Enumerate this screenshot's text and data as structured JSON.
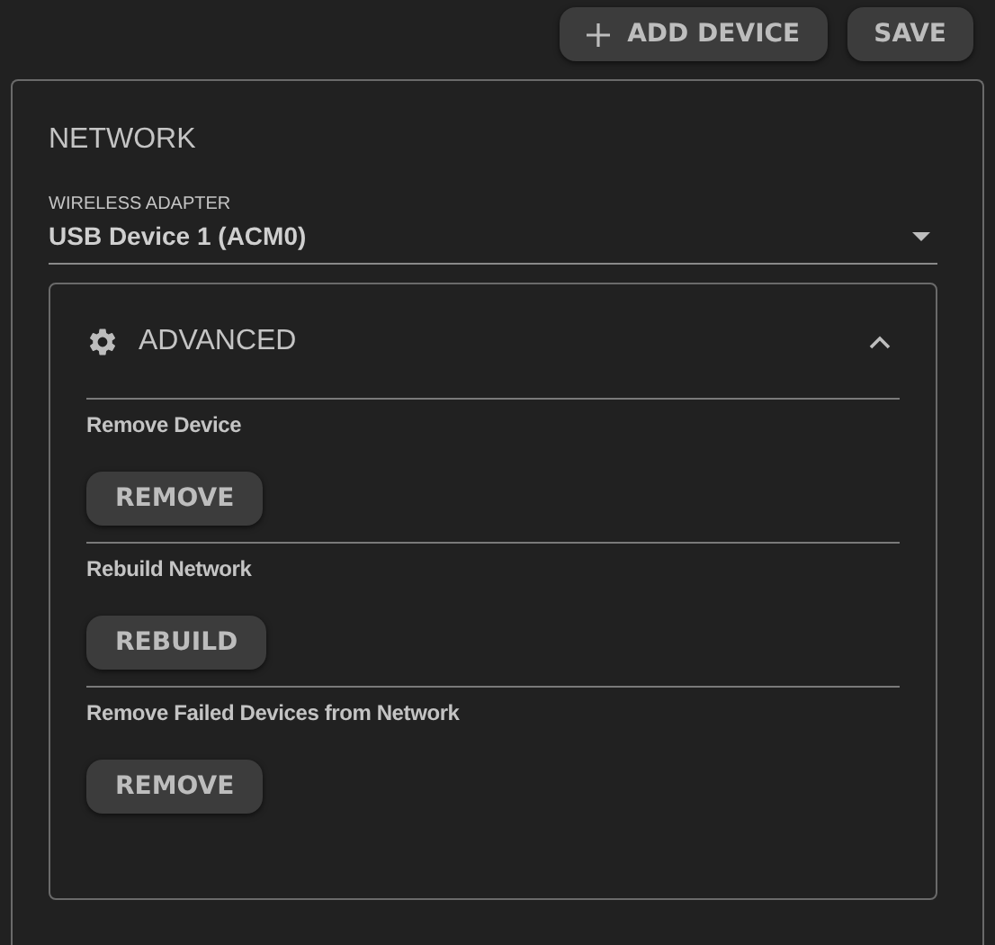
{
  "toolbar": [
    {
      "label": "ADD DEVICE",
      "kind": "add"
    },
    {
      "label": "SAVE",
      "kind": "plain"
    }
  ],
  "network": {
    "title": "NETWORK",
    "adapter": {
      "label": "WIRELESS ADAPTER",
      "value": "USB Device 1 (ACM0)"
    },
    "advanced": {
      "title": "ADVANCED",
      "expanded": true,
      "sections": [
        {
          "label": "Remove Device",
          "button": "REMOVE"
        },
        {
          "label": "Rebuild Network",
          "button": "REBUILD"
        },
        {
          "label": "Remove Failed Devices from Network",
          "button": "REMOVE"
        }
      ]
    }
  }
}
